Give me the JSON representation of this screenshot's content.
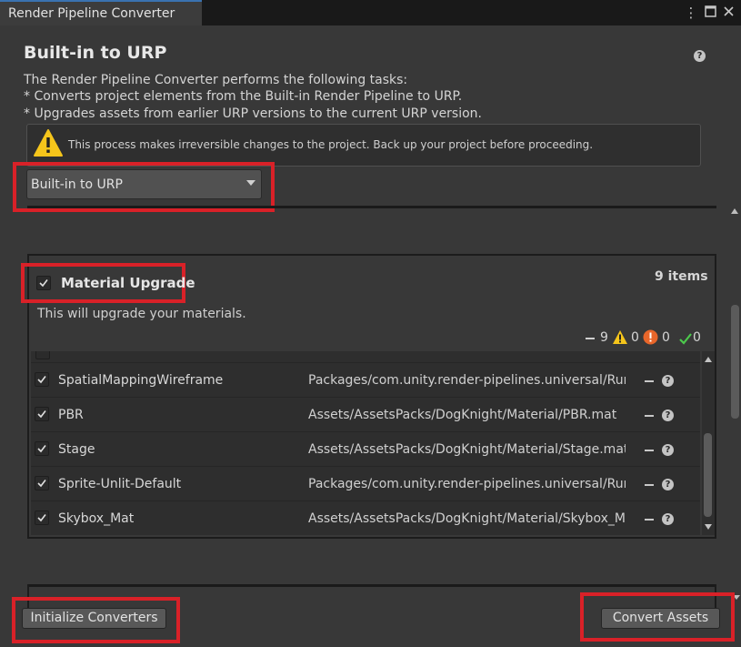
{
  "window": {
    "tab_title": "Render Pipeline Converter",
    "icons": [
      "more-vertical-icon",
      "maximize-icon",
      "close-icon"
    ]
  },
  "header": {
    "title": "Built-in to URP",
    "description_lines": [
      "The Render Pipeline Converter performs the following tasks:",
      "* Converts project elements from the Built-in Render Pipeline to URP.",
      "* Upgrades assets from earlier URP versions to the current URP version."
    ],
    "warning": "This process makes irreversible changes to the project. Back up your project before proceeding.",
    "dropdown_value": "Built-in to URP"
  },
  "converter": {
    "name": "Material Upgrade",
    "checked": true,
    "items_count": "9 items",
    "description": "This will upgrade your materials.",
    "stats": {
      "pending": "9",
      "warnings": "0",
      "errors": "0",
      "success": "0"
    },
    "items": [
      {
        "name": "SpatialMappingWireframe",
        "path": "Packages/com.unity.render-pipelines.universal/Runtime/Materials/SpatialMappingWireframe.mat"
      },
      {
        "name": "PBR",
        "path": "Assets/AssetsPacks/DogKnight/Material/PBR.mat"
      },
      {
        "name": "Stage",
        "path": "Assets/AssetsPacks/DogKnight/Material/Stage.mat"
      },
      {
        "name": "Sprite-Unlit-Default",
        "path": "Packages/com.unity.render-pipelines.universal/Runtime/Materials/Sprite-Unlit-Default.mat"
      },
      {
        "name": "Skybox_Mat",
        "path": "Assets/AssetsPacks/DogKnight/Material/Skybox_Mat.mat"
      }
    ]
  },
  "footer": {
    "initialize_label": "Initialize Converters",
    "convert_label": "Convert Assets"
  },
  "colors": {
    "highlight": "#d92128",
    "warning": "#f5c51b",
    "error": "#e8662a",
    "success": "#4cc94c"
  }
}
